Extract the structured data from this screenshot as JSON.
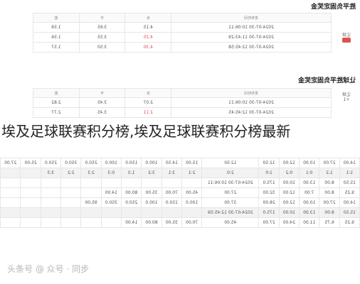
{
  "headline": "埃及足球联赛积分榜,埃及足球联赛积分榜最新",
  "watermark": "头条号 @ 众号 · 同步",
  "section1": {
    "title": "胜平负固定奖金",
    "columns": [
      "胜",
      "平",
      "负",
      "发布时间"
    ],
    "rows": [
      {
        "win": "1.59",
        "draw": "3.65",
        "lose": "4.15",
        "time": "2024-07-30 10:06:11"
      },
      {
        "win": "1.56",
        "draw": "3.55",
        "lose": "4.25",
        "time": "2024-07-30 11:43:29"
      },
      {
        "win": "1.57",
        "draw": "3.50",
        "lose": "4.30",
        "time": "2024-07-30 12:45:58"
      }
    ],
    "side_label": "让球",
    "side_value": ""
  },
  "section2": {
    "title": "让球胜平负固定奖金",
    "columns": [
      "胜",
      "平",
      "负",
      "发布时间"
    ],
    "rows": [
      {
        "win": "2.82",
        "draw": "3.45",
        "lose": "2.07",
        "time": "2024-07-30 10:06:11"
      },
      {
        "win": "2.77",
        "draw": "3.45",
        "lose": "2.11",
        "time": "2024-07-30 12:45:45"
      }
    ],
    "side_label": "让球",
    "side_value": "+1"
  },
  "grid": {
    "rows": [
      [
        "14.00",
        "27.00",
        "10.00",
        "12.00",
        "12.50",
        "12.50",
        "15.00",
        "14.50",
        "100.0",
        "150.0",
        "100.0",
        "250.0",
        "350.0",
        "250.0",
        "25.00",
        "27.00"
      ],
      [
        "1:1",
        "1:2",
        "0:1",
        "0:2",
        "1:0",
        "2:0",
        "2:1",
        "3:1",
        "3:2",
        "1:3",
        "0:3",
        "2:3",
        "2:2",
        "3:3",
        "",
        ""
      ],
      [
        "15.50",
        "8.00",
        "13.00",
        "10.00",
        "175.0",
        "2024-07-30 10:06:11",
        "",
        "",
        "",
        "",
        "",
        "",
        "",
        "",
        "",
        ""
      ],
      [
        "9.25",
        "8.00",
        "7.00",
        "12.00",
        "32.00",
        "27.00",
        "45.00",
        "70.00",
        "35.00",
        "80.00",
        "14.00",
        "",
        "",
        "",
        "",
        ""
      ],
      [
        "14.00",
        "27.00",
        "10.00",
        "12.00",
        "28.00",
        "37.00",
        "100.0",
        "150.0",
        "100.0",
        "250.0",
        "350.0",
        "95.00",
        "",
        "",
        "",
        ""
      ],
      [
        "15.50",
        "8.00",
        "13.00",
        "10.00",
        "175.0",
        "2024-07-30 12:45:59",
        "",
        "",
        "",
        "",
        "",
        "",
        "",
        "",
        "",
        ""
      ],
      [
        "9.25",
        "6.75",
        "11.00",
        "24.00",
        "27.00",
        "45.00",
        "70.00",
        "35.00",
        "80.00",
        "14.00",
        "",
        "",
        "",
        "",
        "",
        ""
      ]
    ]
  }
}
